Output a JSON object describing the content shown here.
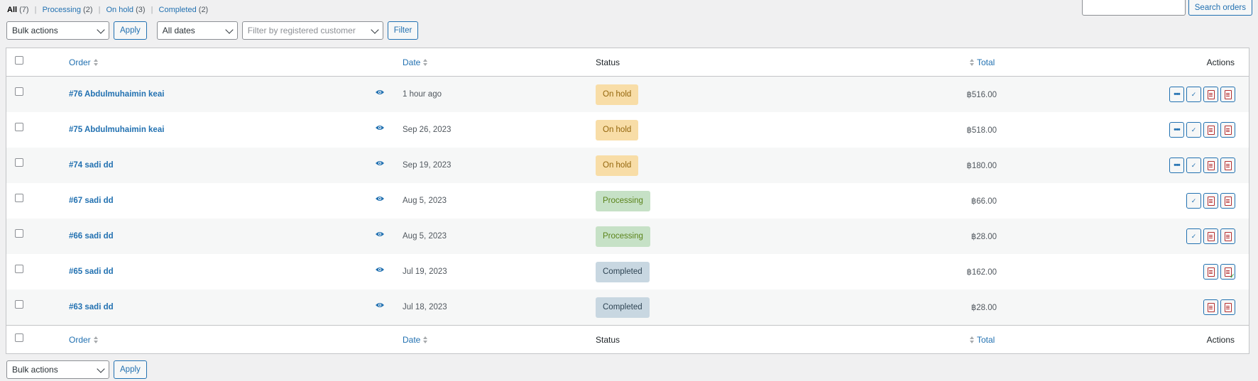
{
  "filters_nav": {
    "all_label": "All",
    "all_count": "(7)",
    "processing_label": "Processing",
    "processing_count": "(2)",
    "onhold_label": "On hold",
    "onhold_count": "(3)",
    "completed_label": "Completed",
    "completed_count": "(2)",
    "separator": "|"
  },
  "search": {
    "input_value": "",
    "button_label": "Search orders"
  },
  "top_nav": {
    "bulk_actions": "Bulk actions",
    "apply_label": "Apply",
    "dates": "All dates",
    "customer_placeholder": "Filter by registered customer",
    "filter_label": "Filter"
  },
  "table": {
    "headers": {
      "order": "Order",
      "date": "Date",
      "status": "Status",
      "total": "Total",
      "actions": "Actions"
    },
    "rows": [
      {
        "order": "#76 Abdulmuhaimin keai",
        "date": "1 hour ago",
        "status": "On hold",
        "status_key": "on-hold",
        "total": "฿516.00",
        "actions": [
          "more",
          "complete",
          "pdf",
          "pdf"
        ]
      },
      {
        "order": "#75 Abdulmuhaimin keai",
        "date": "Sep 26, 2023",
        "status": "On hold",
        "status_key": "on-hold",
        "total": "฿518.00",
        "actions": [
          "more",
          "complete",
          "pdf",
          "pdf"
        ]
      },
      {
        "order": "#74 sadi dd",
        "date": "Sep 19, 2023",
        "status": "On hold",
        "status_key": "on-hold",
        "total": "฿180.00",
        "actions": [
          "more",
          "complete",
          "pdf",
          "pdf"
        ]
      },
      {
        "order": "#67 sadi dd",
        "date": "Aug 5, 2023",
        "status": "Processing",
        "status_key": "processing",
        "total": "฿66.00",
        "actions": [
          "complete",
          "pdf",
          "pdf"
        ]
      },
      {
        "order": "#66 sadi dd",
        "date": "Aug 5, 2023",
        "status": "Processing",
        "status_key": "processing",
        "total": "฿28.00",
        "actions": [
          "complete",
          "pdf",
          "pdf"
        ]
      },
      {
        "order": "#65 sadi dd",
        "date": "Jul 19, 2023",
        "status": "Completed",
        "status_key": "completed",
        "total": "฿162.00",
        "actions": [
          "pdf",
          "pdf-check"
        ]
      },
      {
        "order": "#63 sadi dd",
        "date": "Jul 18, 2023",
        "status": "Completed",
        "status_key": "completed",
        "total": "฿28.00",
        "actions": [
          "pdf",
          "pdf"
        ]
      }
    ]
  },
  "bottom_nav": {
    "bulk_actions": "Bulk actions",
    "apply_label": "Apply"
  },
  "icons": {
    "preview": "eye-icon",
    "more": "ellipsis-icon",
    "complete": "checkmark-icon",
    "pdf": "pdf-document-icon"
  },
  "colors": {
    "link": "#2271b1",
    "on_hold_bg": "#f8dda7",
    "processing_bg": "#c6e1c6",
    "completed_bg": "#c8d7e1",
    "pdf_red": "#b32d2e"
  }
}
